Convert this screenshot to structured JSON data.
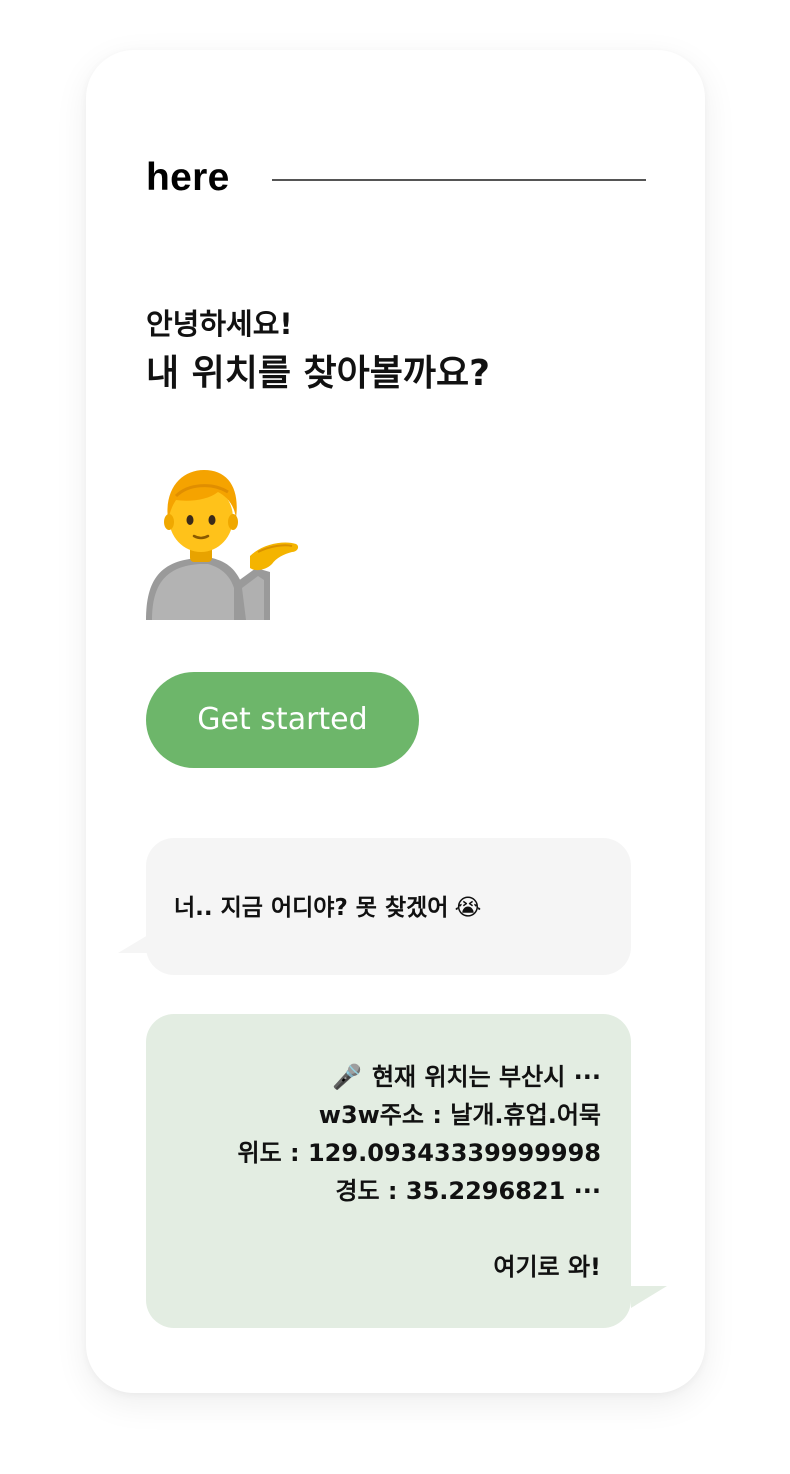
{
  "brand": "here",
  "greeting": {
    "line1": "안녕하세요!",
    "line2": "내 위치를 찾아볼까요?"
  },
  "hero_icon": "person-tipping-hand",
  "cta": {
    "label": "Get started"
  },
  "incoming": {
    "text": "너.. 지금 어디야? 못 찾겠어",
    "emoji": "😭",
    "emoji_name": "loudly-crying-face"
  },
  "outgoing": {
    "mic": "🎤",
    "mic_name": "microphone",
    "line1": "현재 위치는 부산시 ···",
    "line2": "w3w주소 : 날개.휴업.어묵",
    "line3": "위도 : 129.09343339999998",
    "line4": "경도 : 35.2296821 ···",
    "line5": "여기로 와!"
  },
  "colors": {
    "accent": "#6db66a",
    "incoming_bg": "#f5f5f5",
    "outgoing_bg": "#e3ede2",
    "text": "#111111"
  }
}
